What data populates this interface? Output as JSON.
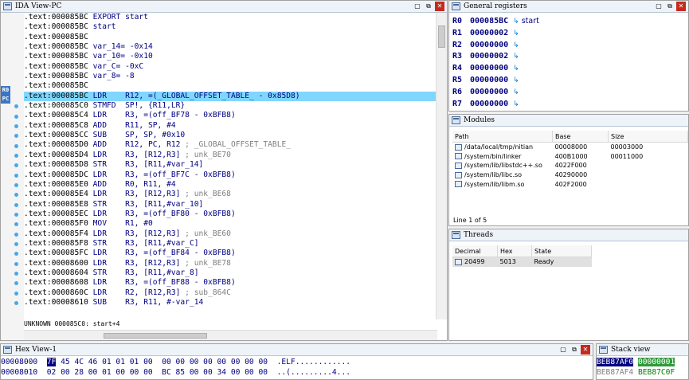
{
  "ida": {
    "title": "IDA View-PC",
    "window_buttons": [
      "▢",
      "⧉",
      "✕"
    ],
    "reg_tags": [
      "R0",
      "PC"
    ],
    "lines": [
      {
        "addr": ".text:000085BC",
        "mn": "EXPORT start",
        "op": "",
        "cm": ""
      },
      {
        "addr": ".text:000085BC",
        "mn": "start",
        "op": "",
        "cm": ""
      },
      {
        "addr": ".text:000085BC",
        "mn": "",
        "op": "",
        "cm": ""
      },
      {
        "addr": ".text:000085BC",
        "mn": "var_14= -0x14",
        "op": "",
        "cm": ""
      },
      {
        "addr": ".text:000085BC",
        "mn": "var_10= -0x10",
        "op": "",
        "cm": ""
      },
      {
        "addr": ".text:000085BC",
        "mn": "var_C= -0xC",
        "op": "",
        "cm": ""
      },
      {
        "addr": ".text:000085BC",
        "mn": "var_8= -8",
        "op": "",
        "cm": ""
      },
      {
        "addr": ".text:000085BC",
        "mn": "",
        "op": "",
        "cm": ""
      },
      {
        "addr": ".text:000085BC",
        "mn": "LDR    ",
        "op": "R12, =(_GLOBAL_OFFSET_TABLE_ - 0x85D8)",
        "cm": ""
      },
      {
        "addr": ".text:000085C0",
        "mn": "STMFD  ",
        "op": "SP!, {R11,LR}",
        "cm": ""
      },
      {
        "addr": ".text:000085C4",
        "mn": "LDR    ",
        "op": "R3, =(off_BF78 - 0xBFB8)",
        "cm": ""
      },
      {
        "addr": ".text:000085C8",
        "mn": "ADD    ",
        "op": "R11, SP, #4",
        "cm": ""
      },
      {
        "addr": ".text:000085CC",
        "mn": "SUB    ",
        "op": "SP, SP, #0x10",
        "cm": ""
      },
      {
        "addr": ".text:000085D0",
        "mn": "ADD    ",
        "op": "R12, PC, R12",
        "cm": " ; _GLOBAL_OFFSET_TABLE_"
      },
      {
        "addr": ".text:000085D4",
        "mn": "LDR    ",
        "op": "R3, [R12,R3]",
        "cm": " ; unk_BE70"
      },
      {
        "addr": ".text:000085D8",
        "mn": "STR    ",
        "op": "R3, [R11,#var_14]",
        "cm": ""
      },
      {
        "addr": ".text:000085DC",
        "mn": "LDR    ",
        "op": "R3, =(off_BF7C - 0xBFB8)",
        "cm": ""
      },
      {
        "addr": ".text:000085E0",
        "mn": "ADD    ",
        "op": "R0, R11, #4",
        "cm": ""
      },
      {
        "addr": ".text:000085E4",
        "mn": "LDR    ",
        "op": "R3, [R12,R3]",
        "cm": " ; unk_BE68"
      },
      {
        "addr": ".text:000085E8",
        "mn": "STR    ",
        "op": "R3, [R11,#var_10]",
        "cm": ""
      },
      {
        "addr": ".text:000085EC",
        "mn": "LDR    ",
        "op": "R3, =(off_BF80 - 0xBFB8)",
        "cm": ""
      },
      {
        "addr": ".text:000085F0",
        "mn": "MOV    ",
        "op": "R1, #0",
        "cm": ""
      },
      {
        "addr": ".text:000085F4",
        "mn": "LDR    ",
        "op": "R3, [R12,R3]",
        "cm": " ; unk_BE60"
      },
      {
        "addr": ".text:000085F8",
        "mn": "STR    ",
        "op": "R3, [R11,#var_C]",
        "cm": ""
      },
      {
        "addr": ".text:000085FC",
        "mn": "LDR    ",
        "op": "R3, =(off_BF84 - 0xBFB8)",
        "cm": ""
      },
      {
        "addr": ".text:00008600",
        "mn": "LDR    ",
        "op": "R3, [R12,R3]",
        "cm": " ; unk_BE78"
      },
      {
        "addr": ".text:00008604",
        "mn": "STR    ",
        "op": "R3, [R11,#var_8]",
        "cm": ""
      },
      {
        "addr": ".text:00008608",
        "mn": "LDR    ",
        "op": "R3, =(off_BF88 - 0xBFB8)",
        "cm": ""
      },
      {
        "addr": ".text:0000860C",
        "mn": "LDR    ",
        "op": "R2, [R12,R3]",
        "cm": " ; sub_864C"
      },
      {
        "addr": ".text:00008610",
        "mn": "SUB    ",
        "op": "R3, R11, #-var_14",
        "cm": ""
      }
    ],
    "highlighted_line": 8,
    "status": "UNKNOWN 000085C0: start+4"
  },
  "registers": {
    "title": "General registers",
    "rows": [
      {
        "name": "R0",
        "value": "000085BC",
        "arrow": "↳",
        "sym": "start"
      },
      {
        "name": "R1",
        "value": "00000002",
        "arrow": "↳",
        "sym": ""
      },
      {
        "name": "R2",
        "value": "00000000",
        "arrow": "↳",
        "sym": ""
      },
      {
        "name": "R3",
        "value": "00000002",
        "arrow": "↳",
        "sym": ""
      },
      {
        "name": "R4",
        "value": "00000000",
        "arrow": "↳",
        "sym": ""
      },
      {
        "name": "R5",
        "value": "00000000",
        "arrow": "↳",
        "sym": ""
      },
      {
        "name": "R6",
        "value": "00000000",
        "arrow": "↳",
        "sym": ""
      },
      {
        "name": "R7",
        "value": "00000000",
        "arrow": "↳",
        "sym": ""
      }
    ]
  },
  "modules": {
    "title": "Modules",
    "headers": [
      "Path",
      "Base",
      "Size"
    ],
    "rows": [
      {
        "path": "/data/local/tmp/nitian",
        "base": "00008000",
        "size": "00003000"
      },
      {
        "path": "/system/bin/linker",
        "base": "400B1000",
        "size": "00011000"
      },
      {
        "path": "/system/lib/libstdc++.so",
        "base": "4022F000",
        "size": ""
      },
      {
        "path": "/system/lib/libc.so",
        "base": "40290000",
        "size": ""
      },
      {
        "path": "/system/lib/libm.so",
        "base": "402F2000",
        "size": ""
      }
    ],
    "footer": "Line 1 of 5"
  },
  "threads": {
    "title": "Threads",
    "headers": [
      "Decimal",
      "Hex",
      "State"
    ],
    "rows": [
      {
        "decimal": "20499",
        "hex": "5013",
        "state": "Ready"
      }
    ]
  },
  "hex": {
    "title": "Hex View-1",
    "lines": [
      {
        "addr": "00008000",
        "sel": "7F",
        "bytes": " 45 4C 46 01 01 01 00  00 00 00 00 00 00 00 00",
        "ascii": ".ELF............"
      },
      {
        "addr": "00008010",
        "sel": "",
        "bytes": "02 00 28 00 01 00 00 00  BC 85 00 00 34 00 00 00",
        "ascii": "..(.........4..."
      }
    ]
  },
  "stack": {
    "title": "Stack view",
    "rows": [
      {
        "addr": "BEB87AF0",
        "value": "00000001"
      },
      {
        "addr": "BEB87AF4",
        "value": "BEB87C0F"
      }
    ]
  },
  "colors": {
    "highlight": "#7fd7ff",
    "code_text": "#000080",
    "comment": "#808080",
    "register_value": "#000080",
    "stack_selected_bg": "#2f9a3a"
  }
}
